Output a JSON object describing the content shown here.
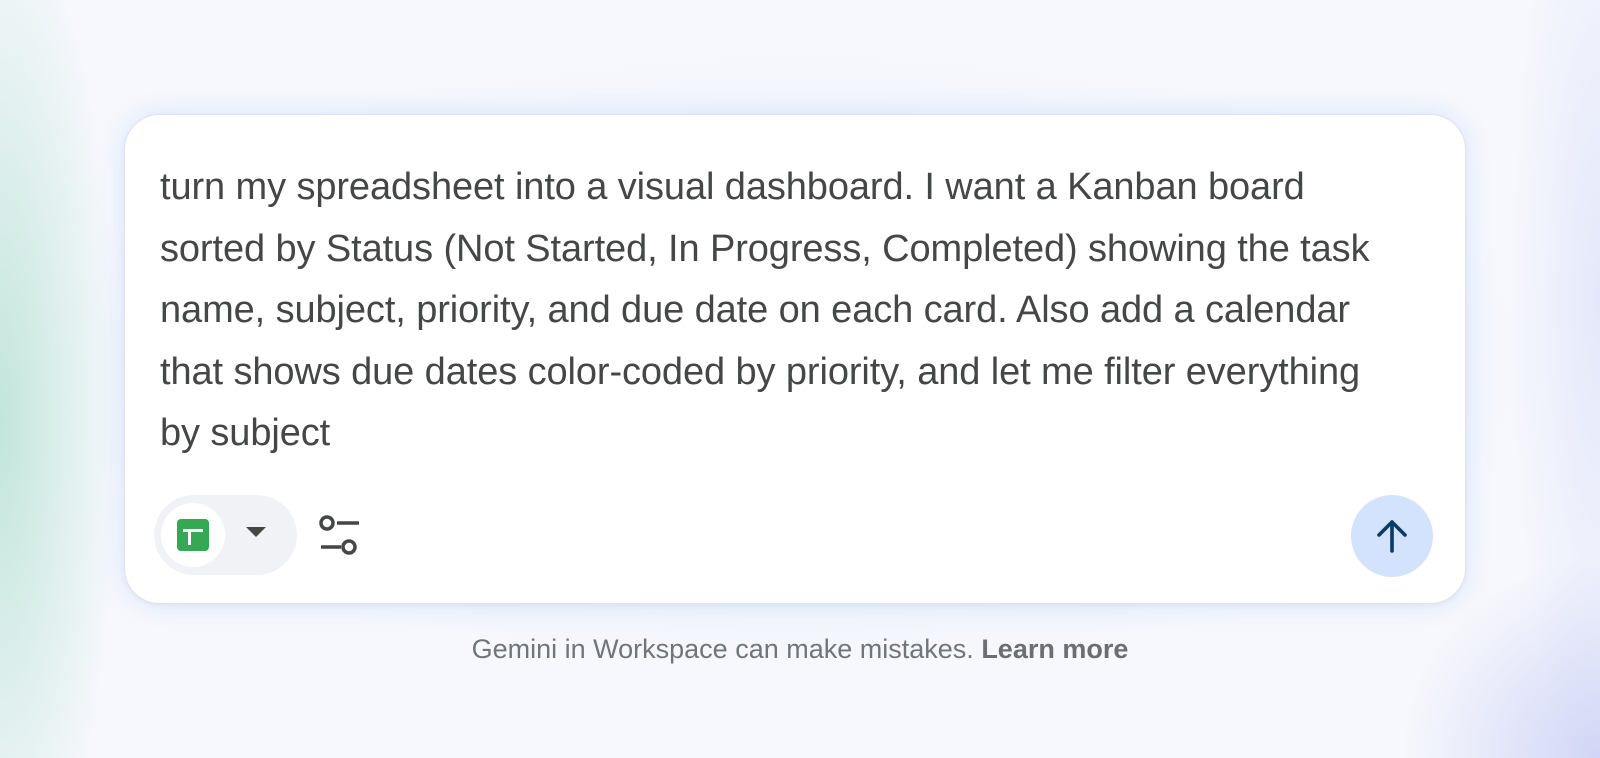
{
  "prompt": {
    "text": "turn my spreadsheet into a visual dashboard. I want a Kanban board sorted by Status (Not Started, In Progress, Completed) showing the task name, subject, priority, and due date on each card. Also add a calendar that shows due dates color-coded by priority, and let me filter everything by subject"
  },
  "toolbar": {
    "source_icon": "google-sheets-icon",
    "dropdown_icon": "caret-down-icon",
    "tools_icon": "tune-sliders-icon",
    "send_icon": "arrow-up-icon"
  },
  "footer": {
    "disclaimer": "Gemini in Workspace can make mistakes.",
    "link_label": "Learn more"
  },
  "colors": {
    "sheets_green": "#34a853",
    "send_button_bg": "#d3e3fd",
    "send_arrow": "#0b3a66",
    "text": "#444746"
  }
}
